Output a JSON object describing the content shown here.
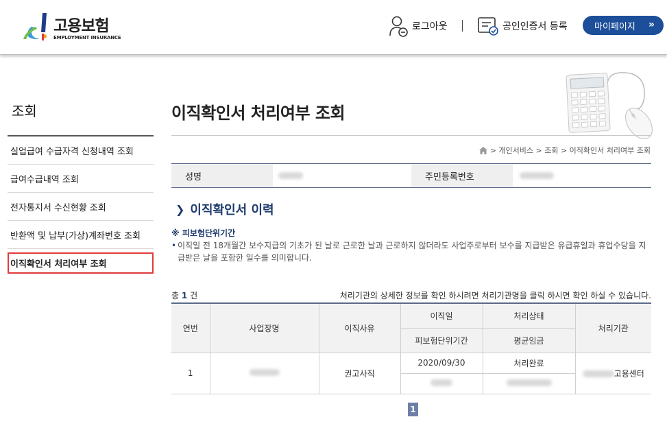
{
  "header": {
    "logo_text": "고용보험",
    "logo_sub": "EMPLOYMENT INSURANCE",
    "logout_label": "로그아웃",
    "cert_label": "공인인증서 등록",
    "mypage_label": "마이페이지",
    "mypage_arrows": "»"
  },
  "sidebar": {
    "title": "조회",
    "items": [
      {
        "label": "실업급여 수급자격 신청내역 조회"
      },
      {
        "label": "급여수급내역 조회"
      },
      {
        "label": "전자통지서 수신현황 조회"
      },
      {
        "label": "반환액 및 납부(가상)계좌번호 조회"
      },
      {
        "label": "이직확인서 처리여부 조회"
      }
    ]
  },
  "main": {
    "page_title": "이직확인서 처리여부 조회",
    "breadcrumb": "> 개인서비스 > 조회 > 이직확인서 처리여부 조회",
    "info": {
      "name_label": "성명",
      "rrn_label": "주민등록번호"
    },
    "section_title": "이직확인서 이력",
    "note_head": "※ 피보험단위기간",
    "note_body": "이직일 전 18개월간 보수지급의 기초가 된 날로 근로한 날과 근로하지 않더라도 사업주로부터 보수를 지급받은 유급휴일과 휴업수당을 지급받은 날을 포함한 일수를 의미합니다.",
    "count_prefix": "총",
    "count_value": "1",
    "count_suffix": "건",
    "hint": "처리기관의 상세한 정보를 확인 하시려면 처리기관명을 클릭 하시면 확인 하실 수 있습니다.",
    "table": {
      "headers": {
        "no": "연번",
        "company": "사업장명",
        "reason": "이직사유",
        "leave_date": "이직일",
        "status": "처리상태",
        "agency": "처리기관",
        "insured_period": "피보험단위기간",
        "avg_wage": "평균임금"
      },
      "rows": [
        {
          "no": "1",
          "reason": "권고사직",
          "leave_date": "2020/09/30",
          "status": "처리완료",
          "agency_suffix": "고용센터"
        }
      ]
    },
    "pagination": {
      "current": "1"
    }
  }
}
